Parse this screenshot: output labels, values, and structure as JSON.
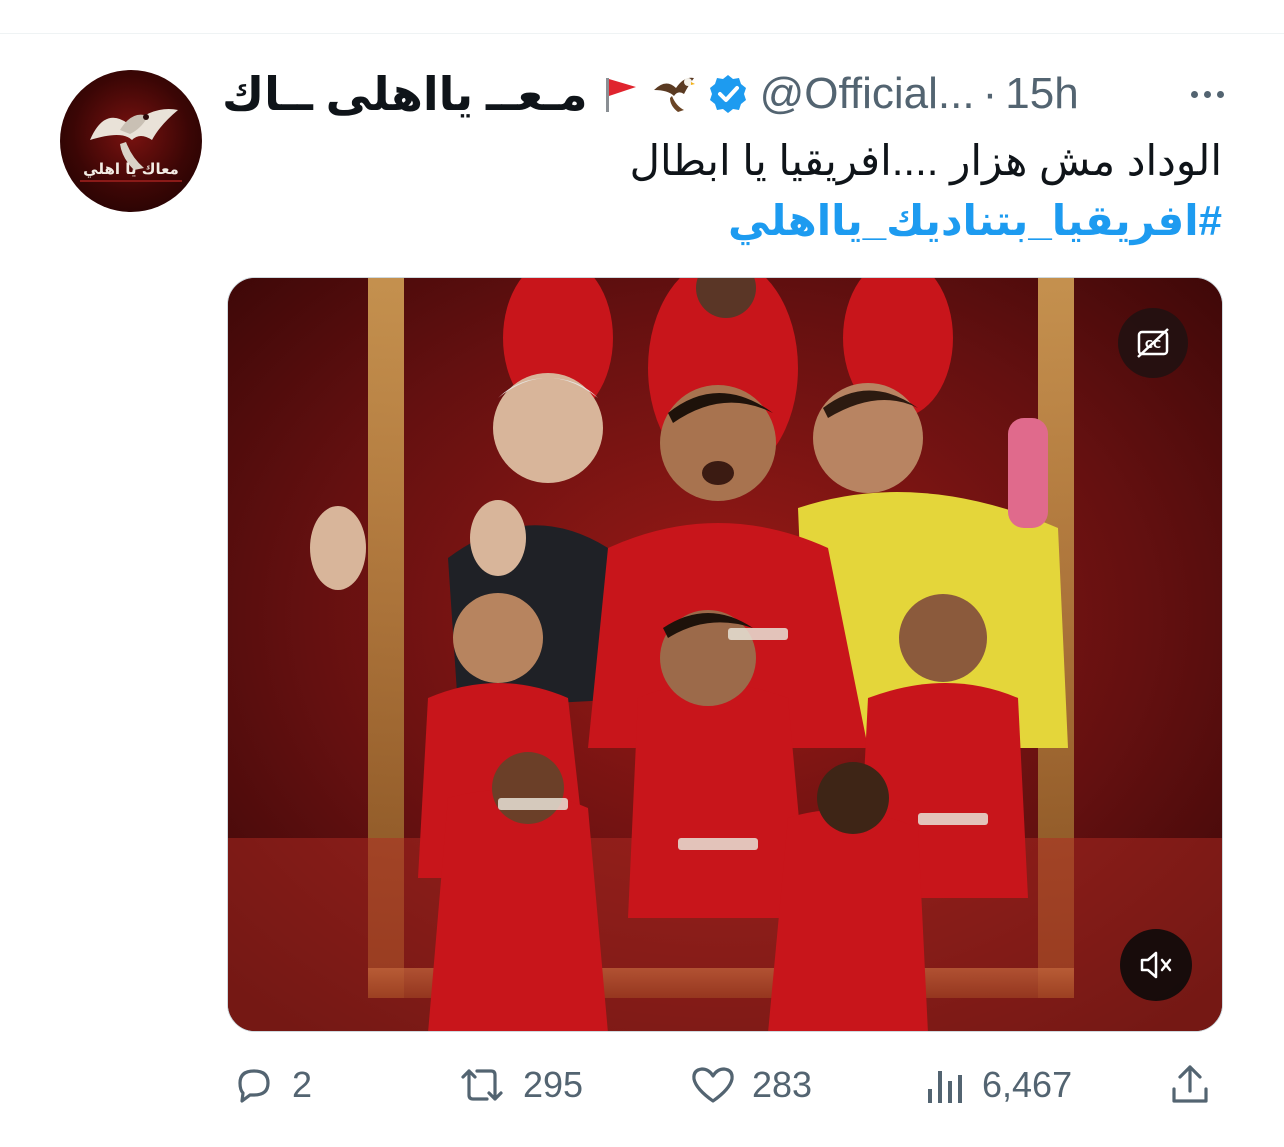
{
  "tweet": {
    "display_name": "مـعــ يااهلى ــاك",
    "flag_emoji": "🚩",
    "eagle_emoji": "🦅",
    "handle": "@Official...",
    "separator": "·",
    "time": "15h",
    "text": "الوداد مش هزار ....افريقيا يا ابطال",
    "hashtag": "#افريقيا_بتناديك_يااهلي",
    "avatar_caption": "معاك يا اهلي",
    "colors": {
      "text": "#0f1419",
      "secondary": "#536471",
      "link": "#1d9bf0",
      "verified": "#1d9bf0",
      "jersey_red": "#c8151b"
    },
    "media": {
      "type": "video",
      "cc_icon": "closed-captions-off-icon",
      "mute_icon": "volume-muted-icon"
    },
    "actions": {
      "replies": "2",
      "retweets": "295",
      "likes": "283",
      "views": "6,467"
    }
  }
}
